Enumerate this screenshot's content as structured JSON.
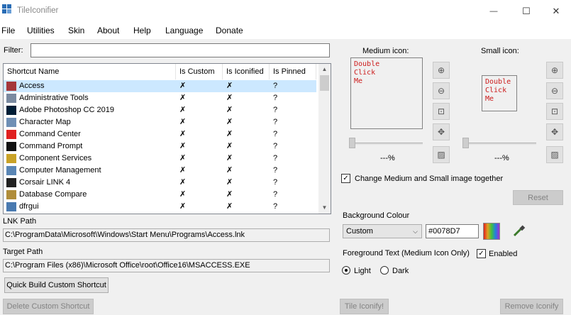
{
  "window": {
    "title": "TileIconifier",
    "minimize": "—",
    "maximize": "☐",
    "close": "✕"
  },
  "menu": [
    "File",
    "Utilities",
    "Skin",
    "About",
    "Help",
    "Language",
    "Donate"
  ],
  "filter": {
    "label": "Filter:",
    "value": ""
  },
  "list": {
    "columns": [
      "Shortcut Name",
      "Is Custom",
      "Is Iconified",
      "Is Pinned"
    ],
    "rows": [
      {
        "name": "Access",
        "custom": "✗",
        "iconified": "✗",
        "pinned": "?",
        "icon_color": "#a4373a"
      },
      {
        "name": "Administrative Tools",
        "custom": "✗",
        "iconified": "✗",
        "pinned": "?",
        "icon_color": "#7a8aa0"
      },
      {
        "name": "Adobe Photoshop CC 2019",
        "custom": "✗",
        "iconified": "✗",
        "pinned": "?",
        "icon_color": "#001e36"
      },
      {
        "name": "Character Map",
        "custom": "✗",
        "iconified": "✗",
        "pinned": "?",
        "icon_color": "#6f8fb5"
      },
      {
        "name": "Command Center",
        "custom": "✗",
        "iconified": "✗",
        "pinned": "?",
        "icon_color": "#e02020"
      },
      {
        "name": "Command Prompt",
        "custom": "✗",
        "iconified": "✗",
        "pinned": "?",
        "icon_color": "#111111"
      },
      {
        "name": "Component Services",
        "custom": "✗",
        "iconified": "✗",
        "pinned": "?",
        "icon_color": "#c9a227"
      },
      {
        "name": "Computer Management",
        "custom": "✗",
        "iconified": "✗",
        "pinned": "?",
        "icon_color": "#5a86b5"
      },
      {
        "name": "Corsair LINK 4",
        "custom": "✗",
        "iconified": "✗",
        "pinned": "?",
        "icon_color": "#222222"
      },
      {
        "name": "Database Compare",
        "custom": "✗",
        "iconified": "✗",
        "pinned": "?",
        "icon_color": "#b08d3a"
      },
      {
        "name": "dfrgui",
        "custom": "✗",
        "iconified": "✗",
        "pinned": "?",
        "icon_color": "#4a7ab0"
      }
    ]
  },
  "lnk": {
    "label": "LNK Path",
    "value": "C:\\ProgramData\\Microsoft\\Windows\\Start Menu\\Programs\\Access.lnk"
  },
  "target": {
    "label": "Target Path",
    "value": "C:\\Program Files (x86)\\Microsoft Office\\root\\Office16\\MSACCESS.EXE"
  },
  "buttons": {
    "quick_build": "Quick Build Custom Shortcut",
    "delete_custom": "Delete Custom Shortcut",
    "tile_iconify": "Tile Iconify!",
    "remove_iconify": "Remove Iconify",
    "reset": "Reset"
  },
  "medium": {
    "label": "Medium icon:",
    "text": "Double\nClick\nMe",
    "percent": "---%"
  },
  "small": {
    "label": "Small icon:",
    "text": "Double\nClick\nMe",
    "percent": "---%"
  },
  "change_together": {
    "label": "Change Medium and Small image together",
    "checked": true
  },
  "background": {
    "label": "Background Colour",
    "selected": "Custom",
    "hex": "#0078D7"
  },
  "foreground": {
    "label": "Foreground Text (Medium Icon Only)",
    "enabled_label": "Enabled",
    "enabled": true,
    "light": "Light",
    "dark": "Dark",
    "selected": "Light"
  },
  "icons": {
    "zoom_in": "zoom-in-icon",
    "zoom_out": "zoom-out-icon",
    "fit": "fit-icon",
    "move": "move-icon",
    "image": "image-icon",
    "eyedropper": "eyedropper-icon",
    "palette": "color-palette-icon"
  }
}
